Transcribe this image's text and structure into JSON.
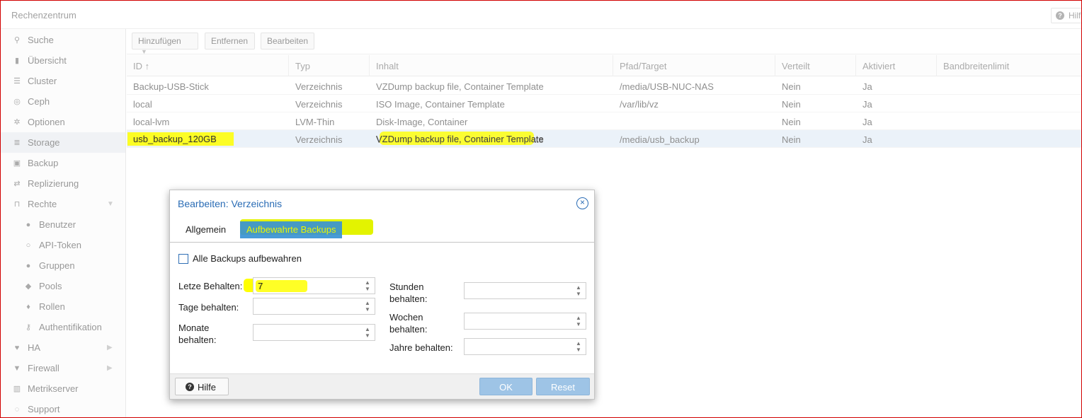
{
  "titlebar": {
    "title": "Rechenzentrum",
    "help": "Hilfe"
  },
  "sidebar": {
    "items": [
      {
        "label": "Suche",
        "icon": "search-icon",
        "glyph": "⚲"
      },
      {
        "label": "Übersicht",
        "icon": "book-icon",
        "glyph": "▮"
      },
      {
        "label": "Cluster",
        "icon": "server-icon",
        "glyph": "☰"
      },
      {
        "label": "Ceph",
        "icon": "ceph-icon",
        "glyph": "◎"
      },
      {
        "label": "Optionen",
        "icon": "gear-icon",
        "glyph": "✲"
      },
      {
        "label": "Storage",
        "icon": "database-icon",
        "glyph": "≣"
      },
      {
        "label": "Backup",
        "icon": "floppy-icon",
        "glyph": "▣"
      },
      {
        "label": "Replizierung",
        "icon": "retweet-icon",
        "glyph": "⇄"
      },
      {
        "label": "Rechte",
        "icon": "unlock-icon",
        "glyph": "⊓"
      },
      {
        "label": "Benutzer",
        "icon": "user-icon",
        "glyph": "●"
      },
      {
        "label": "API-Token",
        "icon": "user-outline-icon",
        "glyph": "○"
      },
      {
        "label": "Gruppen",
        "icon": "users-icon",
        "glyph": "●"
      },
      {
        "label": "Pools",
        "icon": "tags-icon",
        "glyph": "◆"
      },
      {
        "label": "Rollen",
        "icon": "male-icon",
        "glyph": "♦"
      },
      {
        "label": "Authentifikation",
        "icon": "key-icon",
        "glyph": "⚷"
      },
      {
        "label": "HA",
        "icon": "heartbeat-icon",
        "glyph": "♥"
      },
      {
        "label": "Firewall",
        "icon": "shield-icon",
        "glyph": "▼"
      },
      {
        "label": "Metrikserver",
        "icon": "bar-chart-icon",
        "glyph": "▥"
      },
      {
        "label": "Support",
        "icon": "comments-icon",
        "glyph": "◌"
      }
    ]
  },
  "toolbar": {
    "add": "Hinzufügen",
    "remove": "Entfernen",
    "edit": "Bearbeiten"
  },
  "grid": {
    "columns": [
      "ID ↑",
      "Typ",
      "Inhalt",
      "Pfad/Target",
      "Verteilt",
      "Aktiviert",
      "Bandbreitenlimit"
    ],
    "rows": [
      [
        "Backup-USB-Stick",
        "Verzeichnis",
        "VZDump backup file, Container Template",
        "/media/USB-NUC-NAS",
        "Nein",
        "Ja",
        ""
      ],
      [
        "local",
        "Verzeichnis",
        "ISO Image, Container Template",
        "/var/lib/vz",
        "Nein",
        "Ja",
        ""
      ],
      [
        "local-lvm",
        "LVM-Thin",
        "Disk-Image, Container",
        "",
        "Nein",
        "Ja",
        ""
      ],
      [
        "usb_backup_120GB",
        "Verzeichnis",
        "VZDump backup file, Container Template",
        "/media/usb_backup",
        "Nein",
        "Ja",
        ""
      ]
    ]
  },
  "dialog": {
    "title": "Bearbeiten: Verzeichnis",
    "tabs": [
      "Allgemein",
      "Aufbewahrte Backups"
    ],
    "keep_all_label": "Alle Backups aufbewahren",
    "fields": {
      "keep_last": {
        "label": "Letze Behalten:",
        "value": "7"
      },
      "keep_daily": {
        "label": "Tage behalten:",
        "value": ""
      },
      "keep_monthly": {
        "label": "Monate behalten:",
        "value": ""
      },
      "keep_hourly": {
        "label": "Stunden behalten:",
        "value": ""
      },
      "keep_weekly": {
        "label": "Wochen behalten:",
        "value": ""
      },
      "keep_yearly": {
        "label": "Jahre behalten:",
        "value": ""
      }
    },
    "buttons": {
      "help": "Hilfe",
      "ok": "OK",
      "reset": "Reset"
    }
  },
  "colors": {
    "accent": "#3892d4",
    "highlight": "#ffff00",
    "title_blue": "#2a6cb5",
    "frame": "#d10000"
  }
}
